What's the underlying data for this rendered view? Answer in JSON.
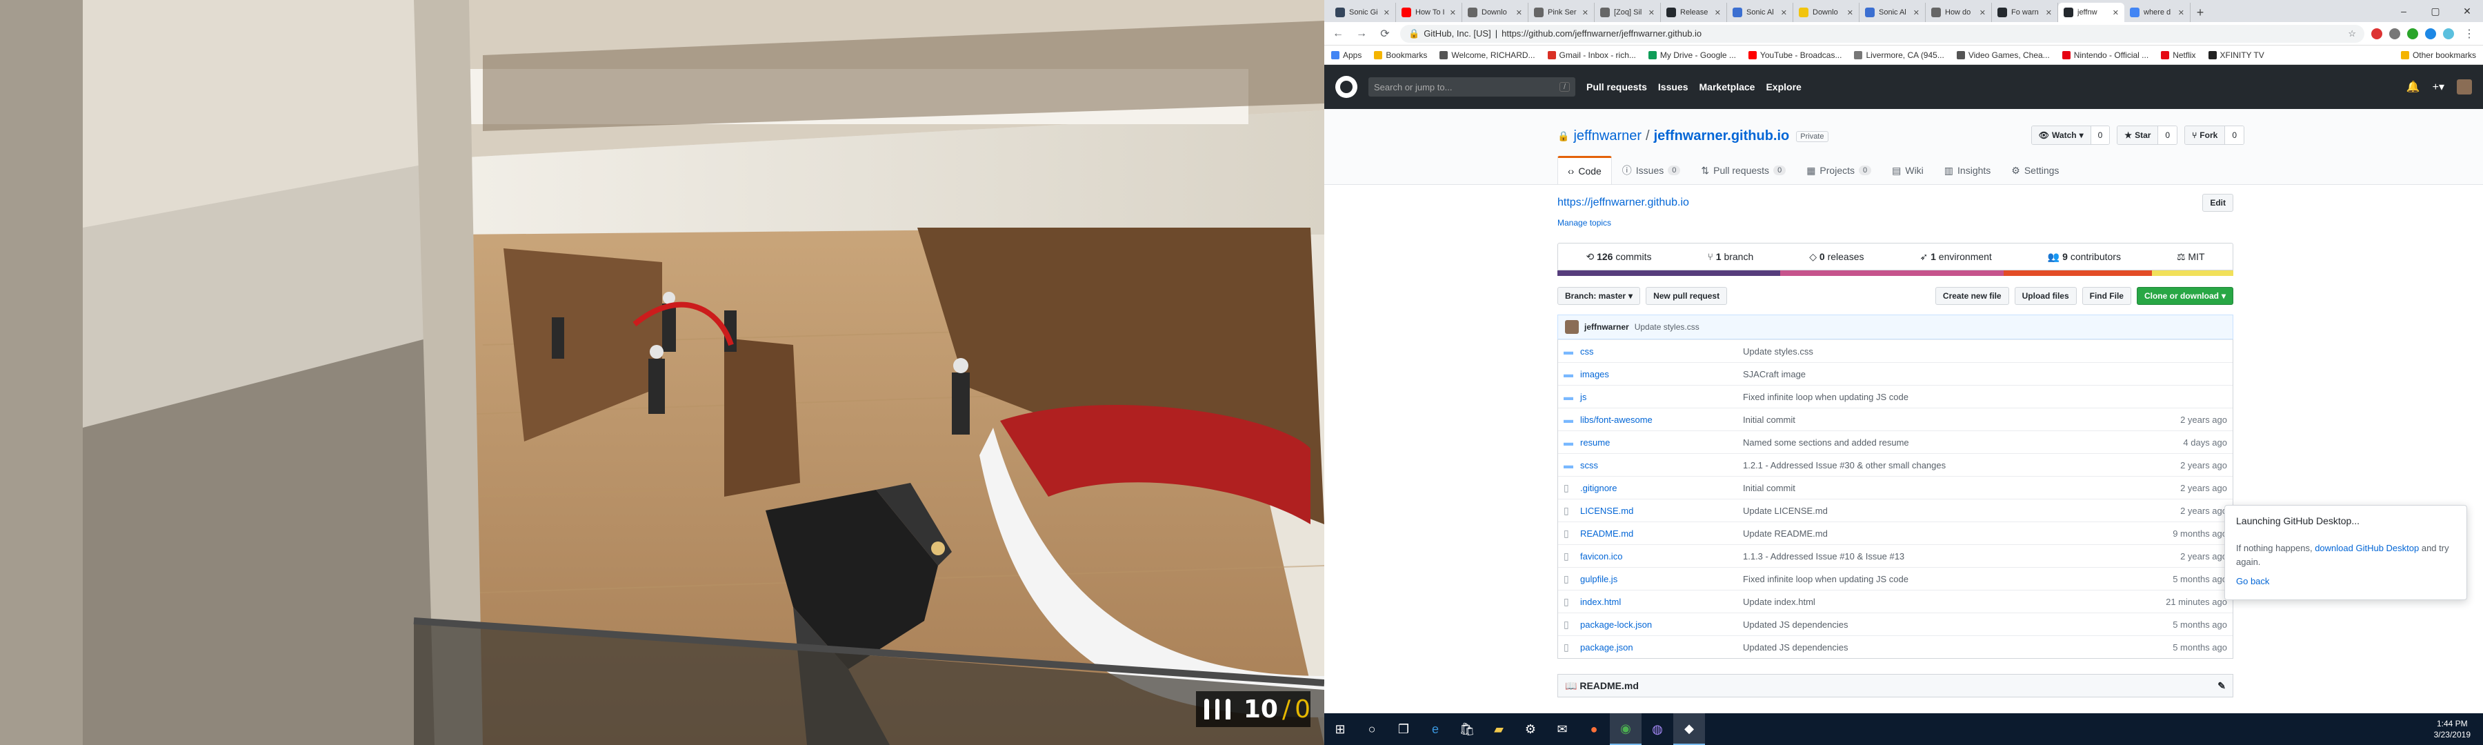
{
  "game": {
    "ammo": {
      "magazine": "10",
      "separator": "/",
      "reserve": "0"
    }
  },
  "browser": {
    "tabs": [
      {
        "label": "Sonic Gi",
        "icon": "tumblr-icon",
        "color": "#35465c"
      },
      {
        "label": "How To I",
        "icon": "youtube-icon",
        "color": "#ff0000"
      },
      {
        "label": "Downlo",
        "icon": "wikipedia-icon",
        "color": "#666666"
      },
      {
        "label": "Pink Ser",
        "icon": "wikipedia-icon",
        "color": "#666666"
      },
      {
        "label": "[Zoq] Sil",
        "icon": "wikipedia-icon",
        "color": "#666666"
      },
      {
        "label": "Release",
        "icon": "github-icon",
        "color": "#24292e"
      },
      {
        "label": "Sonic Al",
        "icon": "sonic-icon",
        "color": "#3b6fd1"
      },
      {
        "label": "Downlo",
        "icon": "banana-icon",
        "color": "#f1c40f"
      },
      {
        "label": "Sonic Al",
        "icon": "sonic-icon",
        "color": "#3b6fd1"
      },
      {
        "label": "How do",
        "icon": "wikipedia-icon",
        "color": "#666666"
      },
      {
        "label": "Fo warn",
        "icon": "github-icon",
        "color": "#24292e"
      },
      {
        "label": "jeffnw",
        "icon": "github-icon",
        "color": "#24292e",
        "active": true
      },
      {
        "label": "where d",
        "icon": "google-icon",
        "color": "#4285f4"
      }
    ],
    "address": {
      "org": "GitHub, Inc. [US]",
      "url": "https://github.com/jeffnwarner/jeffnwarner.github.io"
    },
    "bookmarks": [
      {
        "label": "Apps",
        "color": "#4285f4"
      },
      {
        "label": "Bookmarks",
        "color": "#f4b400"
      },
      {
        "label": "Welcome, RICHARD...",
        "color": "#555555"
      },
      {
        "label": "Gmail - Inbox - rich...",
        "color": "#d93025"
      },
      {
        "label": "My Drive - Google ...",
        "color": "#0f9d58"
      },
      {
        "label": "YouTube - Broadcas...",
        "color": "#ff0000"
      },
      {
        "label": "Livermore, CA (945...",
        "color": "#777777"
      },
      {
        "label": "Video Games, Chea...",
        "color": "#555555"
      },
      {
        "label": "Nintendo - Official ...",
        "color": "#e60012"
      },
      {
        "label": "Netflix",
        "color": "#e50914"
      },
      {
        "label": "XFINITY TV",
        "color": "#222222"
      }
    ],
    "other_bookmarks": "Other bookmarks"
  },
  "github": {
    "search_placeholder": "Search or jump to...",
    "search_key": "/",
    "nav": [
      "Pull requests",
      "Issues",
      "Marketplace",
      "Explore"
    ],
    "repo": {
      "owner": "jeffnwarner",
      "name": "jeffnwarner.github.io",
      "visibility": "Private",
      "watch": {
        "label": "Watch",
        "count": "0"
      },
      "star": {
        "label": "Star",
        "count": "0"
      },
      "fork": {
        "label": "Fork",
        "count": "0"
      }
    },
    "tabs": [
      {
        "label": "Code",
        "count": ""
      },
      {
        "label": "Issues",
        "count": "0"
      },
      {
        "label": "Pull requests",
        "count": "0"
      },
      {
        "label": "Projects",
        "count": "0"
      },
      {
        "label": "Wiki",
        "count": ""
      },
      {
        "label": "Insights",
        "count": ""
      },
      {
        "label": "Settings",
        "count": ""
      }
    ],
    "website": "https://jeffnwarner.github.io",
    "edit": "Edit",
    "manage_topics": "Manage topics",
    "summary": [
      {
        "num": "126",
        "label": "commits"
      },
      {
        "num": "1",
        "label": "branch"
      },
      {
        "num": "0",
        "label": "releases"
      },
      {
        "num": "1",
        "label": "environment"
      },
      {
        "num": "9",
        "label": "contributors"
      },
      {
        "num": "",
        "label": "MIT"
      }
    ],
    "languages": [
      {
        "color": "#563d7c",
        "pct": 0.33
      },
      {
        "color": "#c6538c",
        "pct": 0.33
      },
      {
        "color": "#e34c26",
        "pct": 0.22
      },
      {
        "color": "#f1e05a",
        "pct": 0.12
      }
    ],
    "branch": "Branch: master",
    "new_pr": "New pull request",
    "create_file": "Create new file",
    "upload_files": "Upload files",
    "find_file": "Find File",
    "clone": "Clone or download",
    "last_commit": {
      "author": "jeffnwarner",
      "message": "Update styles.css"
    },
    "files": [
      {
        "name": "css",
        "type": "dir",
        "msg": "Update styles.css",
        "age": ""
      },
      {
        "name": "images",
        "type": "dir",
        "msg": "SJACraft image",
        "age": ""
      },
      {
        "name": "js",
        "type": "dir",
        "msg": "Fixed infinite loop when updating JS code",
        "age": ""
      },
      {
        "name": "libs/font-awesome",
        "type": "dir",
        "msg": "Initial commit",
        "age": "2 years ago"
      },
      {
        "name": "resume",
        "type": "dir",
        "msg": "Named some sections and added resume",
        "age": "4 days ago"
      },
      {
        "name": "scss",
        "type": "dir",
        "msg": "1.2.1 - Addressed Issue #30 & other small changes",
        "age": "2 years ago"
      },
      {
        "name": ".gitignore",
        "type": "file",
        "msg": "Initial commit",
        "age": "2 years ago"
      },
      {
        "name": "LICENSE.md",
        "type": "file",
        "msg": "Update LICENSE.md",
        "age": "2 years ago"
      },
      {
        "name": "README.md",
        "type": "file",
        "msg": "Update README.md",
        "age": "9 months ago"
      },
      {
        "name": "favicon.ico",
        "type": "file",
        "msg": "1.1.3 - Addressed Issue #10 & Issue #13",
        "age": "2 years ago"
      },
      {
        "name": "gulpfile.js",
        "type": "file",
        "msg": "Fixed infinite loop when updating JS code",
        "age": "5 months ago"
      },
      {
        "name": "index.html",
        "type": "file",
        "msg": "Update index.html",
        "age": "21 minutes ago"
      },
      {
        "name": "package-lock.json",
        "type": "file",
        "msg": "Updated JS dependencies",
        "age": "5 months ago"
      },
      {
        "name": "package.json",
        "type": "file",
        "msg": "Updated JS dependencies",
        "age": "5 months ago"
      }
    ],
    "readme": "README.md",
    "popup": {
      "title": "Launching GitHub Desktop...",
      "text_pre": "If nothing happens, ",
      "link": "download GitHub Desktop",
      "text_post": " and try again.",
      "back": "Go back"
    }
  },
  "taskbar": {
    "time": "1:44 PM",
    "date": "3/23/2019"
  }
}
